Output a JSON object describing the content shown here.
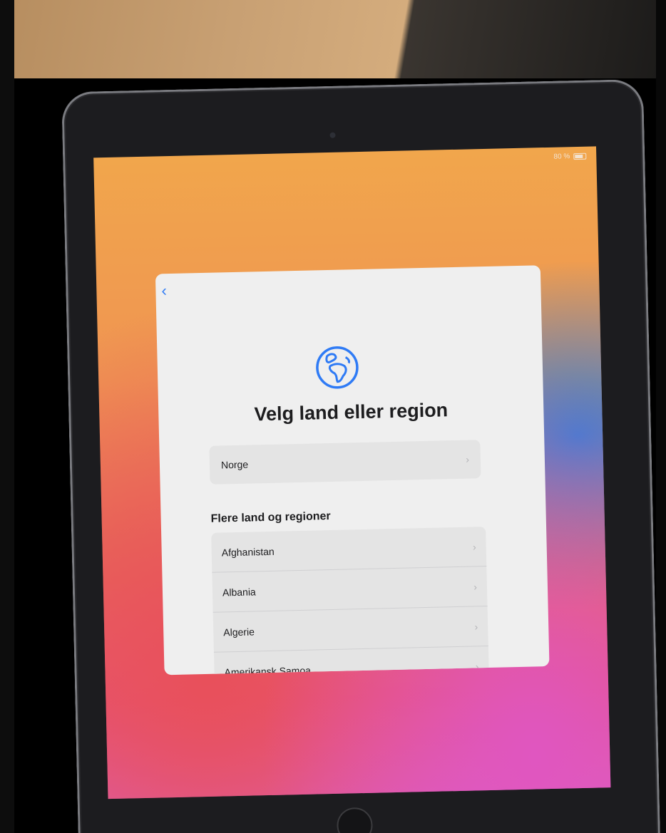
{
  "status_bar": {
    "battery_text": "80 %",
    "battery_level": 0.8
  },
  "card": {
    "back_icon": "chevron-left-icon",
    "globe_icon": "globe-icon",
    "title": "Velg land eller region",
    "current_country": "Norge",
    "section_header": "Flere land og regioner",
    "countries": [
      "Afghanistan",
      "Albania",
      "Algerie",
      "Amerikansk Samoa"
    ]
  },
  "colors": {
    "accent": "#2f7bf5",
    "card_background": "#efefef",
    "row_background": "#e4e4e4"
  }
}
